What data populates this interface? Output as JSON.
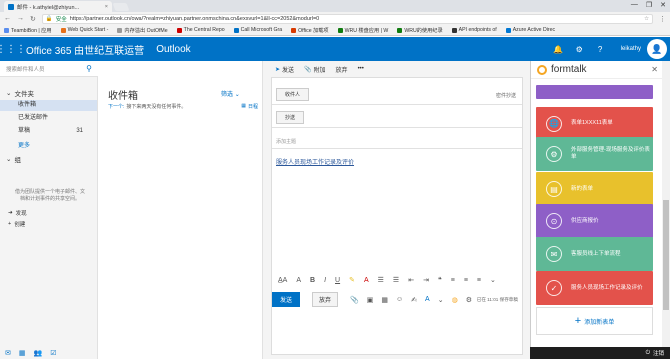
{
  "browser": {
    "tab_title": "邮件 - k.athyiel@zhiyun...",
    "tab_close": "×",
    "window_controls": [
      "—",
      "❐",
      "✕"
    ],
    "url_secure_label": "安全",
    "url": "https://partner.outlook.cn/owa/?realm=zhiyuan.partner.onmschina.cn&exsvurl=1&ll-cc=2052&modurl=0",
    "bookmarks": [
      "TeambiBon | 应用",
      "Web Quick Start -",
      "内存溢出 OutOfMe",
      "The Central Repo",
      "Call Microsoft Gra",
      "Office 加载项",
      "WRU 楼盘应用 | W",
      "WRU的使用纪录",
      "API endpoints of",
      "Azure Active Direc"
    ]
  },
  "header": {
    "brand": "Office 365 由世纪互联运营",
    "app": "Outlook",
    "user": "leikathy",
    "avatar_text": "👤"
  },
  "leftnav": {
    "search_placeholder": "搜索邮件和人员",
    "folders_title": "文件夹",
    "folders": [
      {
        "label": "收件箱",
        "count": ""
      },
      {
        "label": "已发送邮件",
        "count": ""
      },
      {
        "label": "草稿",
        "count": "31"
      }
    ],
    "more": "更多",
    "groups_title": "组",
    "groups_desc": "借为团队提供一个电子邮件、文档和计划事件的共享空间。",
    "discover": "发现",
    "create": "创建"
  },
  "msglist": {
    "title": "收件箱",
    "filter": "筛选",
    "empty_prefix": "下一个:",
    "empty_text": "接下来两天没有任何事件。",
    "schedule": "日程"
  },
  "compose": {
    "toolbar": {
      "send": "发送",
      "attach": "附加",
      "discard": "放弃",
      "more": "•••"
    },
    "to_btn": "收件人",
    "cc_btn": "抄送",
    "ccbcc": "密件抄送",
    "subject_placeholder": "添加主题",
    "body_link": "服务人员现场工作记录及评价",
    "send_btn": "发送",
    "discard_btn": "放弃",
    "draft_status": "已在 11:01 保存草稿"
  },
  "formtalk": {
    "title": "formtalk",
    "cards": [
      {
        "text": "",
        "color": "#8e5fc7",
        "icon": ""
      },
      {
        "text": "表单1XXX11表单",
        "color": "#e3524b",
        "icon": "🌐"
      },
      {
        "text": "外部服务管理-现场服务及评价表单",
        "color": "#5fb896",
        "icon": "⚙"
      },
      {
        "text": "新的表单",
        "color": "#e8c12c",
        "icon": "▤"
      },
      {
        "text": "供应商报价",
        "color": "#8e5fc7",
        "icon": "⊙"
      },
      {
        "text": "客服员线上下单流程",
        "color": "#5fb896",
        "icon": "✉"
      },
      {
        "text": "服务人员现场工作记录及评价",
        "color": "#e3524b",
        "icon": "✓"
      }
    ],
    "add_label": "添加新表单"
  },
  "taskbar": {
    "label": "注销"
  }
}
